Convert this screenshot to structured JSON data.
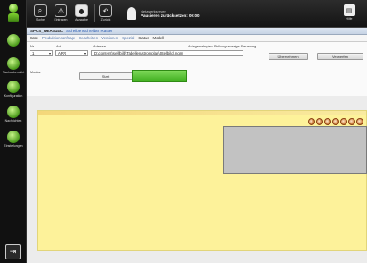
{
  "toolbar": {
    "tools": [
      {
        "label": "Suche",
        "icon": "search-icon"
      },
      {
        "label": "Eintragen",
        "icon": "warning-icon"
      },
      {
        "label": "Ausgabe",
        "icon": "bulb-icon"
      },
      {
        "label": "Zurück",
        "icon": "undo-icon"
      }
    ],
    "status_line1": "Netzwerkserver",
    "status_line2": "Pausieren zurücksetzen: 00:00",
    "right_label": "Hilfe"
  },
  "sidebar": {
    "items": [
      "",
      "Tischuebersicht",
      "Konfiguration",
      "Nachrichten",
      "Einstellungen"
    ]
  },
  "window": {
    "title": "SPCS_MEAS14C",
    "subtitle": "Scheibenschreiber Raster"
  },
  "menu": [
    "Datei",
    "Produktionsanfrage",
    "Bearbeiten",
    "Versionen",
    "Spezial",
    "Status",
    "Modell"
  ],
  "form": {
    "labels": {
      "nr": "Nr.",
      "art": "Art",
      "path": "Adresse",
      "desc": "Anlagenfahrplan Stellungsanzeige Steuerung",
      "mode": "Modus"
    },
    "nr_value": "1",
    "art_value": "ARR",
    "path_value": "D:\\content\\stellbild\\Tabellen\\stromplan\\Stellbild.mgm",
    "btn1": "Übernehmen",
    "btn2": "Verwerfen",
    "btn_small": "Start",
    "btn_green": ""
  },
  "colors": {
    "accent_green": "#3fae1f",
    "canvas_yellow": "#fdf29a",
    "dot_orange": "#d68b4a"
  },
  "canvas": {
    "dot_count": 7
  }
}
